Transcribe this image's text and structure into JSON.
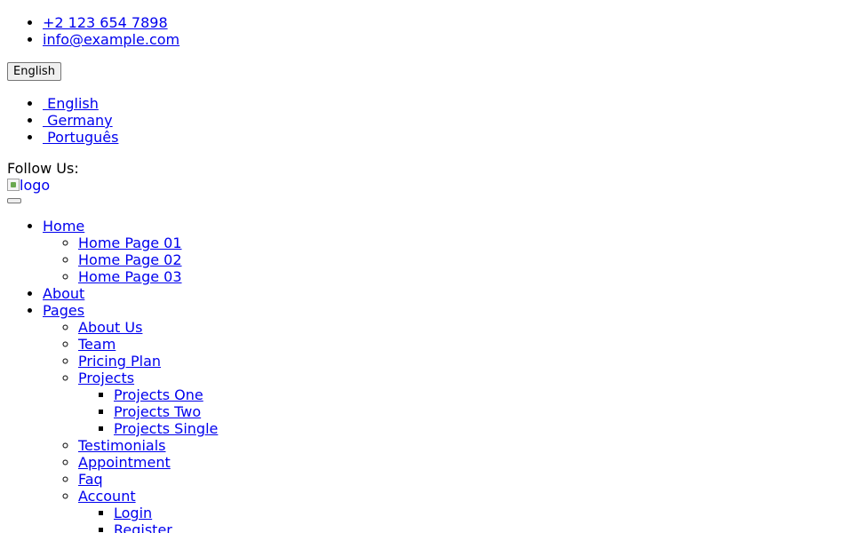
{
  "contact": {
    "phone": "+2 123 654 7898",
    "email": "info@example.com"
  },
  "language": {
    "button_label": "English",
    "options": [
      {
        "label": " English"
      },
      {
        "label": " Germany"
      },
      {
        "label": " Português"
      }
    ]
  },
  "social": {
    "follow_label": "Follow Us:"
  },
  "logo": {
    "alt": "logo"
  },
  "nav": {
    "home": {
      "label": "Home",
      "children": [
        "Home Page 01",
        "Home Page 02",
        "Home Page 03"
      ]
    },
    "about": {
      "label": "About"
    },
    "pages": {
      "label": "Pages",
      "about_us": "About Us",
      "team": "Team",
      "pricing_plan": "Pricing Plan",
      "projects": {
        "label": "Projects",
        "children": [
          "Projects One",
          "Projects Two",
          "Projects Single"
        ]
      },
      "testimonials": "Testimonials",
      "appointment": "Appointment",
      "faq": "Faq",
      "account": {
        "label": "Account",
        "children": [
          "Login",
          "Register"
        ]
      }
    }
  }
}
